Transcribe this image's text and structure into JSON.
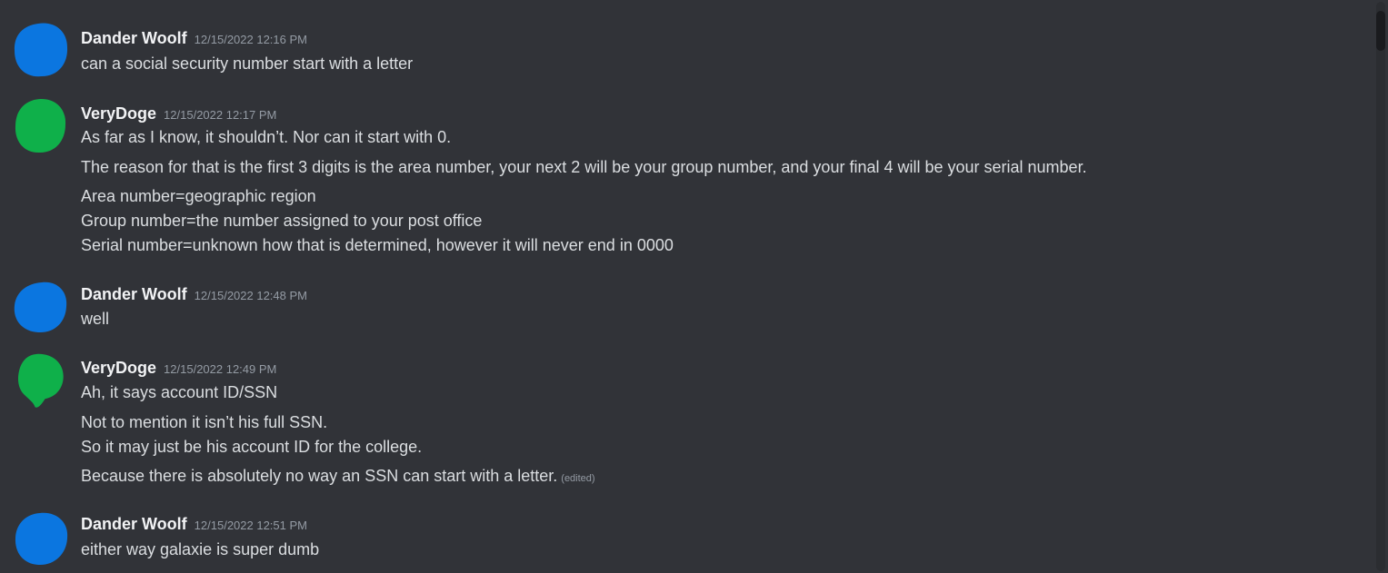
{
  "messages": [
    {
      "author": "Dander Woolf",
      "timestamp": "12/15/2022 12:16 PM",
      "avatar_color": "#0b76e0",
      "lines": [
        "can a social security number start with a letter"
      ]
    },
    {
      "author": "VeryDoge",
      "timestamp": "12/15/2022 12:17 PM",
      "avatar_color": "#0fb04a",
      "lines": [
        "As far as I know, it shouldn’t. Nor can it start with 0.",
        "The reason for that is the first 3 digits is the area number, your next 2 will be your group number, and your final 4 will be your serial number.",
        "Area number=geographic region",
        "Group number=the number assigned to your post office",
        "Serial number=unknown how that is determined, however it will never end in 0000"
      ]
    },
    {
      "author": "Dander Woolf",
      "timestamp": "12/15/2022 12:48 PM",
      "avatar_color": "#0b76e0",
      "lines": [
        "well"
      ]
    },
    {
      "author": "VeryDoge",
      "timestamp": "12/15/2022 12:49 PM",
      "avatar_color": "#0fb04a",
      "lines": [
        "Ah, it says account ID/SSN",
        "Not to mention it isn’t his full SSN.",
        "So it may just be his account ID for the college.",
        "Because there is absolutely no way an SSN can start with a letter."
      ],
      "edited_label": "(edited)"
    },
    {
      "author": "Dander Woolf",
      "timestamp": "12/15/2022 12:51 PM",
      "avatar_color": "#0b76e0",
      "lines": [
        "either way galaxie is super dumb"
      ]
    }
  ]
}
